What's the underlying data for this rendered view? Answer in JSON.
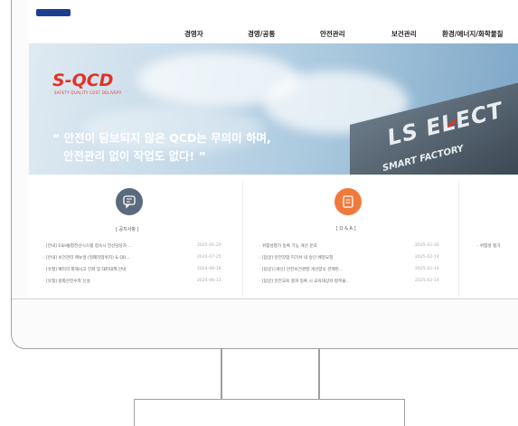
{
  "nav": {
    "items": [
      "경영자",
      "경영/공통",
      "안전관리",
      "보건관리",
      "환경/에너지/화학물질"
    ]
  },
  "logo": {
    "subtext": ""
  },
  "hero": {
    "brand": "S-QCD",
    "brand_sub": "SAFETY QUALITY COST DELIVERY",
    "slogan_line1": "“ 안전이 담보되지 않은 QCD는 무의미 하며,",
    "slogan_line2": "안전관리 없이 작업도 없다! ”",
    "building_text": "LS ELECT",
    "building_sub": "SMART FACTORY"
  },
  "notice": {
    "title": "[ 공지사항 ]",
    "rows": [
      {
        "text": "· [안내] ESH통합전산시스템 접속시 전산담당자 ...",
        "date": "2025-01-20"
      },
      {
        "text": "· [안내] 보건관리 매뉴얼 (밀폐작업위치) & QR...",
        "date": "2024-07-25"
      },
      {
        "text": "· [유형] 배터리 화재사고 진화 및 대피대책 안내",
        "date": "2024-06-18"
      },
      {
        "text": "· [유형] 방화안전수칙 신설",
        "date": "2024-06-13"
      }
    ]
  },
  "qna": {
    "title": "[ Q & A ]",
    "rows": [
      {
        "text": "· 위험성평가 등록 기능 개선 문의",
        "date": "2025-02-20"
      },
      {
        "text": "· [답글] 안전작업 허가서 내 승인 배정요청",
        "date": "2025-02-14"
      },
      {
        "text": "· [답글] [개선] 안전보건경영 개선양식 관계된...",
        "date": "2025-02-14"
      },
      {
        "text": "· [답글] 안전교육 결과 등록 시 교육대상자 항목을...",
        "date": "2025-02-14"
      }
    ]
  },
  "third": {
    "rows": [
      {
        "text": "· 위험성 평가"
      }
    ]
  },
  "colors": {
    "notice_icon": "#5b6b7e",
    "qna_icon": "#f07a3c",
    "accent_red": "#e53224"
  }
}
